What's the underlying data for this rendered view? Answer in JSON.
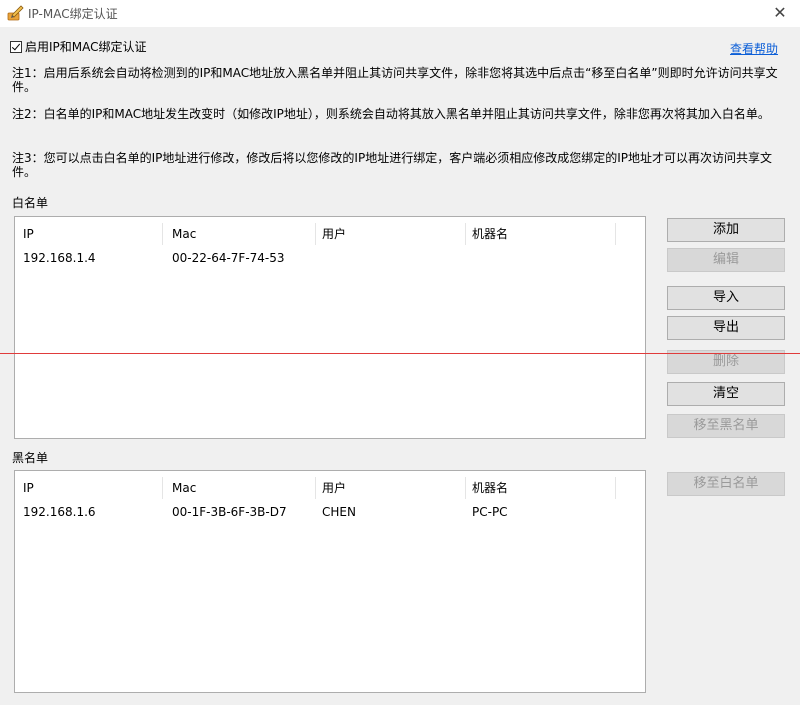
{
  "window": {
    "title": "IP-MAC绑定认证",
    "close_glyph": "✕"
  },
  "enable": {
    "label": "启用IP和MAC绑定认证",
    "checked": true
  },
  "help_link": "查看帮助",
  "notes": [
    "注1：启用后系统会自动将检测到的IP和MAC地址放入黑名单并阻止其访问共享文件，除非您将其选中后点击“移至白名单”则即时允许访问共享文件。",
    "注2：白名单的IP和MAC地址发生改变时（如修改IP地址），则系统会自动将其放入黑名单并阻止其访问共享文件，除非您再次将其加入白名单。",
    "注3：您可以点击白名单的IP地址进行修改，修改后将以您修改的IP地址进行绑定，客户端必须相应修改成您绑定的IP地址才可以再次访问共享文件。"
  ],
  "whitelist": {
    "label": "白名单",
    "columns": [
      "IP",
      "Mac",
      "用户",
      "机器名"
    ],
    "rows": [
      {
        "ip": "192.168.1.4",
        "mac": "00-22-64-7F-74-53",
        "user": "",
        "machine": ""
      }
    ]
  },
  "blacklist": {
    "label": "黑名单",
    "columns": [
      "IP",
      "Mac",
      "用户",
      "机器名"
    ],
    "rows": [
      {
        "ip": "192.168.1.6",
        "mac": "00-1F-3B-6F-3B-D7",
        "user": "CHEN",
        "machine": "PC-PC"
      }
    ]
  },
  "buttons": {
    "add": "添加",
    "edit": "编辑",
    "import": "导入",
    "export": "导出",
    "delete": "删除",
    "clear": "清空",
    "move_to_black": "移至黑名单",
    "move_to_white": "移至白名单"
  },
  "colors": {
    "link": "#0b5ed7",
    "annotation_line": "#e03b3b"
  }
}
